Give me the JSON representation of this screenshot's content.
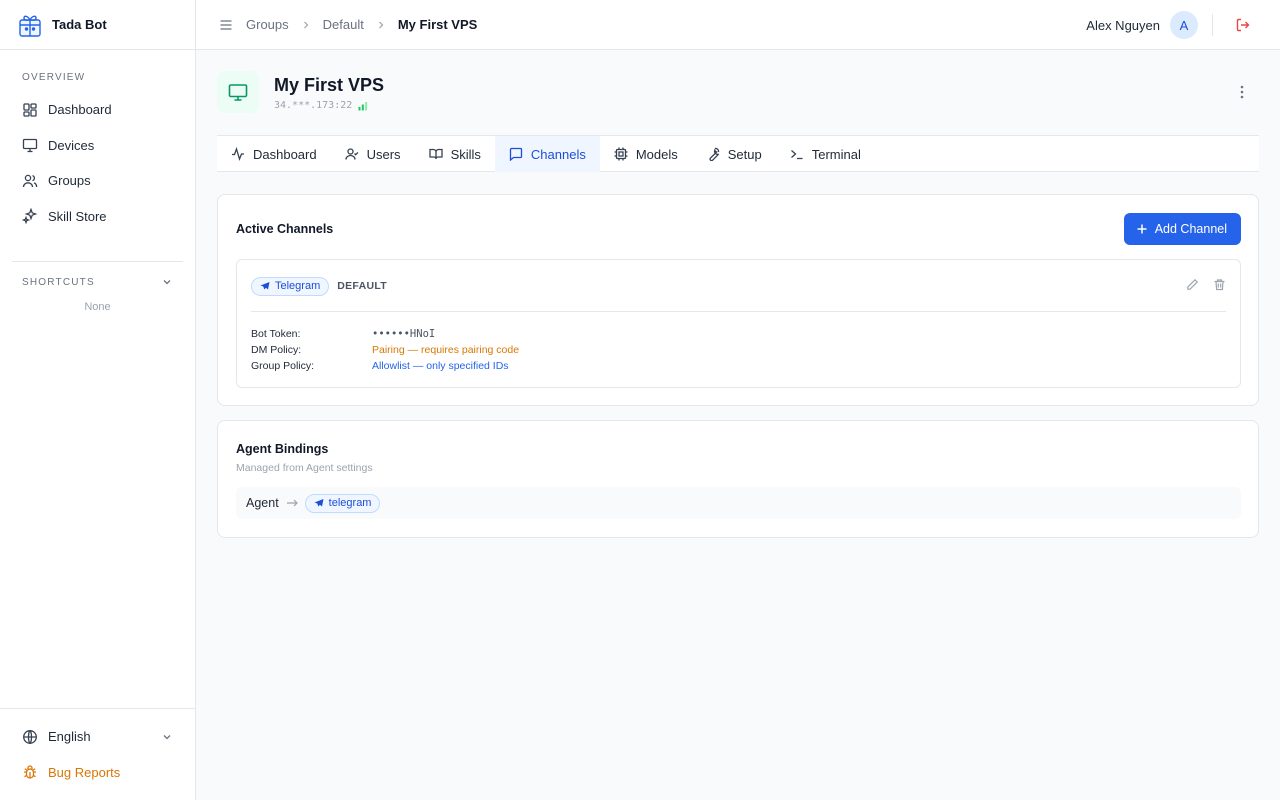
{
  "app": {
    "name": "Tada Bot"
  },
  "sidebar": {
    "overview_title": "OVERVIEW",
    "items": [
      {
        "label": "Dashboard",
        "icon": "grid-icon"
      },
      {
        "label": "Devices",
        "icon": "monitor-icon"
      },
      {
        "label": "Groups",
        "icon": "users-icon"
      },
      {
        "label": "Skill Store",
        "icon": "sparkles-icon"
      }
    ],
    "shortcuts_title": "SHORTCUTS",
    "shortcuts_empty": "None",
    "language": "English",
    "bug_reports": "Bug Reports"
  },
  "breadcrumb": {
    "items": [
      "Groups",
      "Default",
      "My First VPS"
    ]
  },
  "user": {
    "name": "Alex Nguyen",
    "initial": "A"
  },
  "device": {
    "name": "My First VPS",
    "address": "34.***.173:22"
  },
  "tabs": [
    {
      "label": "Dashboard",
      "icon": "activity-icon"
    },
    {
      "label": "Users",
      "icon": "user-check-icon"
    },
    {
      "label": "Skills",
      "icon": "book-open-icon"
    },
    {
      "label": "Channels",
      "icon": "message-square-icon"
    },
    {
      "label": "Models",
      "icon": "cpu-icon"
    },
    {
      "label": "Setup",
      "icon": "wrench-icon"
    },
    {
      "label": "Terminal",
      "icon": "terminal-icon"
    }
  ],
  "active_tab": "Channels",
  "channels": {
    "title": "Active Channels",
    "add_label": "Add Channel",
    "item": {
      "type": "Telegram",
      "tag": "DEFAULT",
      "rows": [
        {
          "label": "Bot Token:",
          "value": "••••••HNoI"
        },
        {
          "label": "DM Policy:",
          "value": "Pairing — requires pairing code"
        },
        {
          "label": "Group Policy:",
          "value": "Allowlist — only specified IDs"
        }
      ]
    }
  },
  "bindings": {
    "title": "Agent Bindings",
    "subtitle": "Managed from Agent settings",
    "agent": "Agent",
    "channel": "telegram"
  },
  "colors": {
    "accent": "#2563eb",
    "warning": "#d97706",
    "danger": "#ef4444",
    "success": "#059669"
  }
}
